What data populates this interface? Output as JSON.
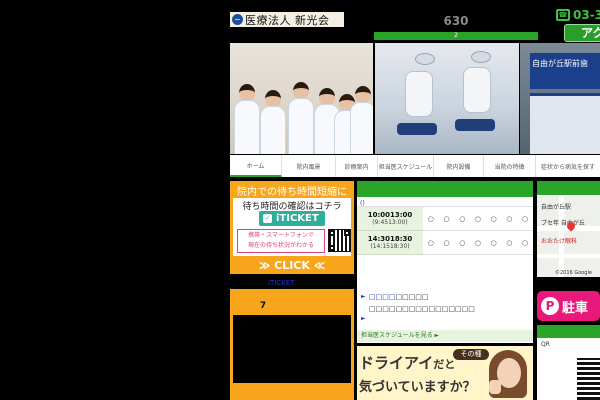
{
  "header": {
    "clinic_name": "医療法人 新光会",
    "counter": "630",
    "counter_bar": "2",
    "tel": "03-3",
    "access_label": "アク"
  },
  "photos": {
    "store_sign": "自由が丘駅前歯"
  },
  "nav": {
    "items": [
      {
        "label": "ホーム"
      },
      {
        "label": "院内風景"
      },
      {
        "label": "診療案内"
      },
      {
        "label": "担当医スケジュール"
      },
      {
        "label": "院内設備"
      },
      {
        "label": "当院の特徴"
      },
      {
        "label": "症状から病気を探す"
      }
    ]
  },
  "wait": {
    "title": "院内での待ち時間短縮に",
    "subtitle": "待ち時間の確認はコチラ",
    "iticket": "iTICKET",
    "note_line1": "携帯・スマートフォンで",
    "note_line2": "現在の待ち状況がわかる",
    "click": "≫ CLICK ≪",
    "link": "iTICKET"
  },
  "info": {
    "number": "7"
  },
  "schedule": {
    "label": "()",
    "rows": [
      {
        "time": "10:0013:00",
        "sub": "(9:4513:00)",
        "marks": [
          "○",
          "○",
          "○",
          "○",
          "○",
          "○",
          "○"
        ]
      },
      {
        "time": "14:3018:30",
        "sub": "(14:1518:30)",
        "marks": [
          "○",
          "○",
          "○",
          "○",
          "○",
          "○",
          "○"
        ]
      }
    ],
    "news_blue": "□□□□",
    "news_rest": "□□□□□",
    "news_sub": "□□□□□□□□□□□□□□□□",
    "more": "担当医スケジュールを見る ►"
  },
  "ad": {
    "tag": "その種",
    "line1": "ドライアイ",
    "line1_small": "だと",
    "line2": "気づいていますか？"
  },
  "map": {
    "station": "自由が丘駅",
    "label1": "プセ年 自由が丘",
    "label2": "おおたけ眼科",
    "copyright": "©2016 Google"
  },
  "parking": {
    "letter": "P",
    "label": "駐車"
  },
  "qr": {
    "label": "QR"
  },
  "colors": {
    "accent_green": "#2aa52a",
    "orange": "#f7a51b",
    "pink": "#e8197a"
  }
}
